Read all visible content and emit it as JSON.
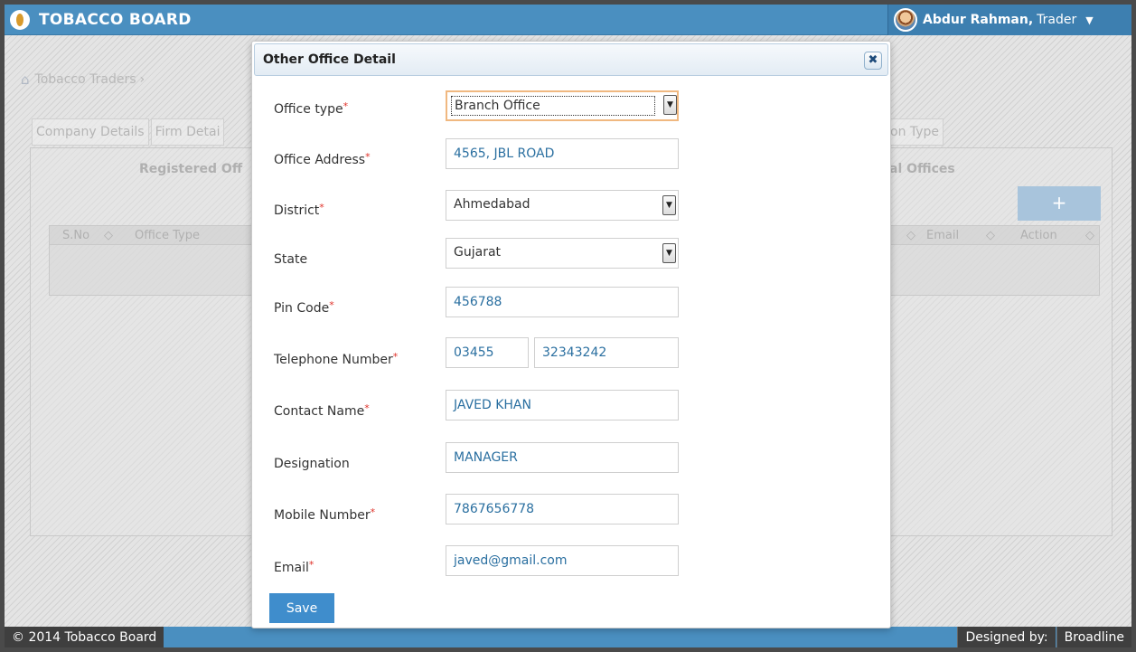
{
  "app": {
    "brand": "TOBACCO BOARD",
    "user_name": "Abdur Rahman,",
    "user_role": "Trader"
  },
  "background": {
    "breadcrumb": "Tobacco Traders",
    "tabs": [
      "Company Details",
      "Firm Detai"
    ],
    "tab_right": "on Type",
    "panel_title_left": "Registered Off",
    "panel_title_right": "al Offices",
    "add_label": "+",
    "table_headers": {
      "sno": "S.No",
      "office_type": "Office Type",
      "email": "Email",
      "action": "Action"
    }
  },
  "modal": {
    "title": "Other Office Detail",
    "close_label": "✖",
    "fields": {
      "office_type": {
        "label": "Office type",
        "required": "*",
        "value": "Branch Office"
      },
      "office_address": {
        "label": "Office Address",
        "required": "*",
        "value": "4565, JBL ROAD"
      },
      "district": {
        "label": "District",
        "required": "*",
        "value": "Ahmedabad"
      },
      "state": {
        "label": "State",
        "value": "Gujarat"
      },
      "pin_code": {
        "label": "Pin Code",
        "required": "*",
        "value": "456788"
      },
      "telephone": {
        "label": "Telephone Number",
        "required": "*",
        "std_code": "03455",
        "number": "32343242"
      },
      "contact_name": {
        "label": "Contact Name",
        "required": "*",
        "value": "JAVED KHAN"
      },
      "designation": {
        "label": "Designation",
        "value": "MANAGER"
      },
      "mobile": {
        "label": "Mobile Number",
        "required": "*",
        "value": "7867656778"
      },
      "email": {
        "label": "Email",
        "required": "*",
        "value": "javed@gmail.com"
      }
    },
    "save_label": "Save"
  },
  "footer": {
    "copyright": "© 2014 Tobacco Board",
    "designed_by_label": "Designed by:",
    "designer": "Broadline"
  },
  "colors": {
    "header_blue": "#4a8fc0",
    "footer_dark": "#3f3f3f",
    "save_button": "#3f8dcc",
    "required_star": "#e0322a",
    "value_text": "#2a6fa0"
  }
}
